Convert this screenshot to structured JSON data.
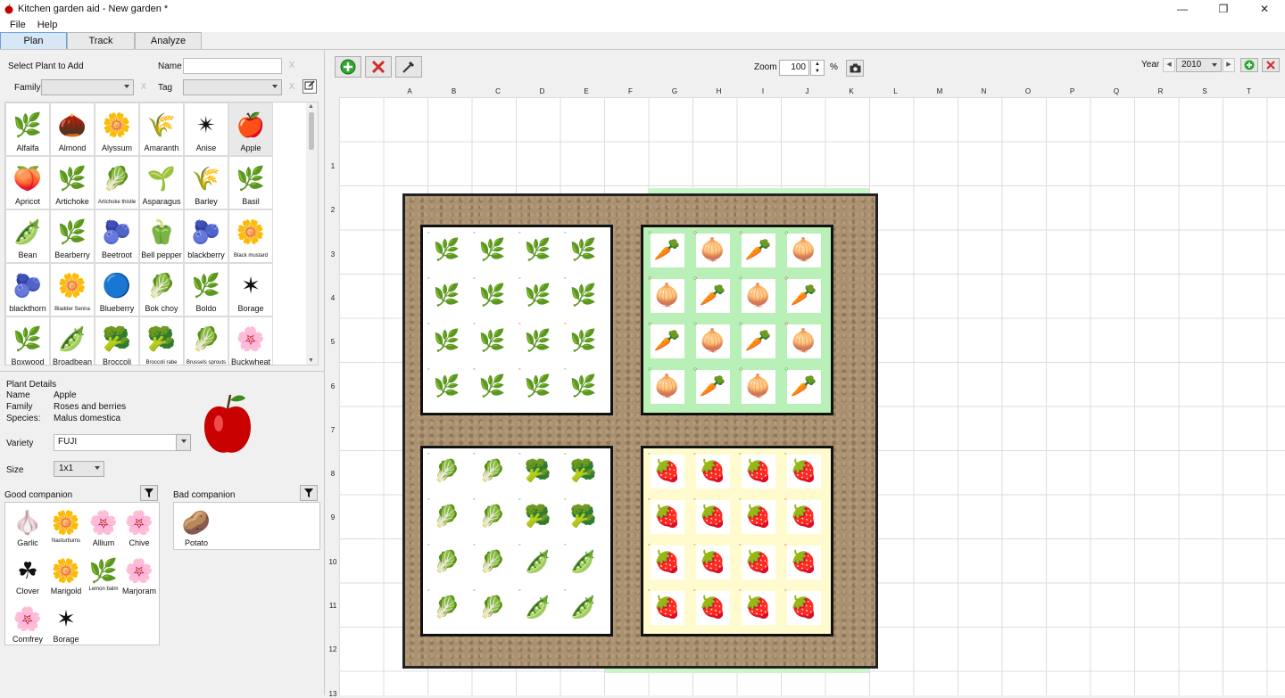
{
  "window": {
    "title": "Kitchen garden aid - New garden *",
    "controls": [
      "—",
      "❐",
      "✕"
    ]
  },
  "menu": [
    "File",
    "Help"
  ],
  "tabs": [
    "Plan",
    "Track",
    "Analyze"
  ],
  "left": {
    "select_title": "Select Plant to Add",
    "name_label": "Name",
    "family_label": "Family",
    "tag_label": "Tag",
    "clear": "X",
    "plants": [
      {
        "name": "Alfalfa",
        "icon": "🌿"
      },
      {
        "name": "Almond",
        "icon": "🌰"
      },
      {
        "name": "Alyssum",
        "icon": "🌼"
      },
      {
        "name": "Amaranth",
        "icon": "🌾"
      },
      {
        "name": "Anise",
        "icon": "✴"
      },
      {
        "name": "Apple",
        "icon": "🍎"
      },
      {
        "name": "Apricot",
        "icon": "🍑"
      },
      {
        "name": "Artichoke",
        "icon": "🌿"
      },
      {
        "name": "Artichoke thistle",
        "icon": "🥬"
      },
      {
        "name": "Asparagus",
        "icon": "🌱"
      },
      {
        "name": "Barley",
        "icon": "🌾"
      },
      {
        "name": "Basil",
        "icon": "🌿"
      },
      {
        "name": "Bean",
        "icon": "🫛"
      },
      {
        "name": "Bearberry",
        "icon": "🌿"
      },
      {
        "name": "Beetroot",
        "icon": "🫐"
      },
      {
        "name": "Bell pepper",
        "icon": "🫑"
      },
      {
        "name": "blackberry",
        "icon": "🫐"
      },
      {
        "name": "Black mustard",
        "icon": "🌼"
      },
      {
        "name": "blackthorn",
        "icon": "🫐"
      },
      {
        "name": "Bladder Senna",
        "icon": "🌼"
      },
      {
        "name": "Blueberry",
        "icon": "🔵"
      },
      {
        "name": "Bok choy",
        "icon": "🥬"
      },
      {
        "name": "Boldo",
        "icon": "🌿"
      },
      {
        "name": "Borage",
        "icon": "✶"
      },
      {
        "name": "Boxwood",
        "icon": "🌿"
      },
      {
        "name": "Broadbean",
        "icon": "🫛"
      },
      {
        "name": "Broccoli",
        "icon": "🥦"
      },
      {
        "name": "Broccoli rabe",
        "icon": "🥦"
      },
      {
        "name": "Brussels sprouts",
        "icon": "🥬"
      },
      {
        "name": "Buckwheat",
        "icon": "🌸"
      }
    ],
    "details": {
      "title": "Plant Details",
      "name_label": "Name",
      "name_value": "Apple",
      "family_label": "Family",
      "family_value": "Roses and berries",
      "species_label": "Species:",
      "species_value": "Malus domestica",
      "variety_label": "Variety",
      "variety_value": "FUJI",
      "size_label": "Size",
      "size_value": "1x1"
    },
    "good_title": "Good companion",
    "bad_title": "Bad companion",
    "good": [
      {
        "name": "Garlic",
        "icon": "🧄"
      },
      {
        "name": "Nasturtiums",
        "icon": "🌼"
      },
      {
        "name": "Allium",
        "icon": "🌸"
      },
      {
        "name": "Chive",
        "icon": "🌸"
      },
      {
        "name": "Clover",
        "icon": "☘"
      },
      {
        "name": "Marigold",
        "icon": "🌼"
      },
      {
        "name": "Lemon balm",
        "icon": "🌿"
      },
      {
        "name": "Marjoram",
        "icon": "🌸"
      },
      {
        "name": "Comfrey",
        "icon": "🌸"
      },
      {
        "name": "Borage",
        "icon": "✶"
      }
    ],
    "bad": [
      {
        "name": "Potato",
        "icon": "🥔"
      }
    ]
  },
  "toolbar": {
    "zoom_label": "Zoom",
    "zoom_value": "100",
    "zoom_unit": "%",
    "year_label": "Year",
    "year_value": "2010"
  },
  "grid": {
    "columns": [
      "A",
      "B",
      "C",
      "D",
      "E",
      "F",
      "G",
      "H",
      "I",
      "J",
      "K",
      "L",
      "M",
      "N",
      "O",
      "P",
      "Q",
      "R",
      "S",
      "T"
    ],
    "rows": [
      "1",
      "2",
      "3",
      "4",
      "5",
      "6",
      "7",
      "8",
      "9",
      "10",
      "11",
      "12",
      "13"
    ]
  },
  "beds": [
    {
      "name": "bed-top-left",
      "plants": [
        "🌿",
        "🌿",
        "🌿",
        "🌿",
        "🌿",
        "🌿",
        "🌿",
        "🌿",
        "🌿",
        "🌿",
        "🌿",
        "🌿",
        "🌿",
        "🌿",
        "🌿",
        "🌿"
      ]
    },
    {
      "name": "bed-top-right",
      "plants": [
        "🥕",
        "🧅",
        "🥕",
        "🧅",
        "🧅",
        "🥕",
        "🧅",
        "🥕",
        "🥕",
        "🧅",
        "🥕",
        "🧅",
        "🧅",
        "🥕",
        "🧅",
        "🥕"
      ]
    },
    {
      "name": "bed-bottom-left",
      "plants": [
        "🥬",
        "🥬",
        "🥦",
        "🥦",
        "🥬",
        "🥬",
        "🥦",
        "🥦",
        "🥬",
        "🥬",
        "🫛",
        "🫛",
        "🥬",
        "🥬",
        "🫛",
        "🫛"
      ]
    },
    {
      "name": "bed-bottom-right",
      "plants": [
        "🍓",
        "🍓",
        "🍓",
        "🍓",
        "🍓",
        "🍓",
        "🍓",
        "🍓",
        "🍓",
        "🍓",
        "🍓",
        "🍓",
        "🍓",
        "🍓",
        "🍓",
        "🍓"
      ]
    }
  ]
}
